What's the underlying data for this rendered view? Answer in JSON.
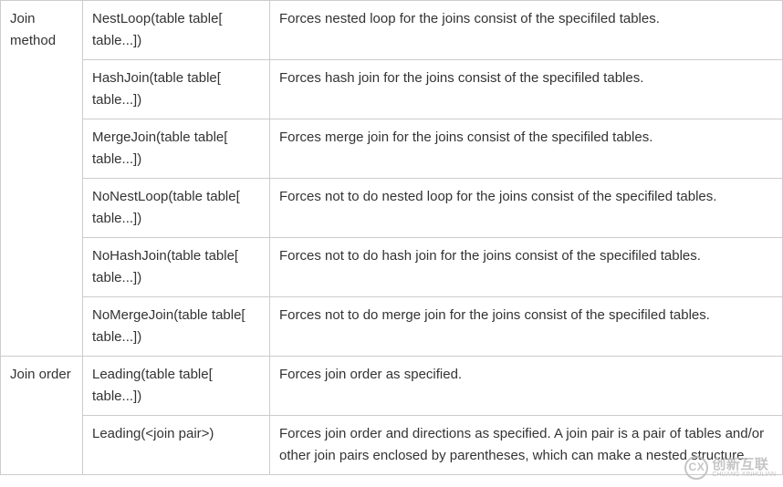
{
  "rows": [
    {
      "category": "Join method",
      "hint": "NestLoop(table table[ table...])",
      "desc": "Forces nested loop for the joins consist of the specifiled tables."
    },
    {
      "category": "",
      "hint": "HashJoin(table table[ table...])",
      "desc": "Forces hash join for the joins consist of the specifiled tables."
    },
    {
      "category": "",
      "hint": "MergeJoin(table table[ table...])",
      "desc": "Forces merge join for the joins consist of the specifiled tables."
    },
    {
      "category": "",
      "hint": "NoNestLoop(table table[ table...])",
      "desc": "Forces not to do nested loop for the joins consist of the specifiled tables."
    },
    {
      "category": "",
      "hint": "NoHashJoin(table table[ table...])",
      "desc": "Forces not to do hash join for the joins consist of the specifiled tables."
    },
    {
      "category": "",
      "hint": "NoMergeJoin(table table[ table...])",
      "desc": "Forces not to do merge join for the joins consist of the specifiled tables."
    },
    {
      "category": "Join order",
      "hint": "Leading(table table[ table...])",
      "desc": "Forces join order as specified."
    },
    {
      "category": "",
      "hint": "Leading(<join pair>)",
      "desc": "Forces join order and directions as specified. A join pair is a pair of tables and/or other join pairs enclosed by parentheses, which can make a nested structure."
    }
  ],
  "cat1_rowspan": 6,
  "cat2_rowspan": 2,
  "watermark": {
    "logo_text": "CX",
    "text": "创新互联",
    "sub": "CHUANG XINHULIAN"
  }
}
